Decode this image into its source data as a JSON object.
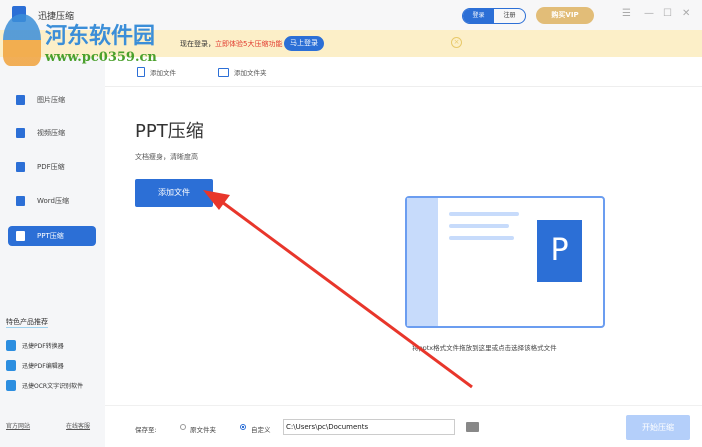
{
  "app": {
    "title": "迅捷压缩"
  },
  "header": {
    "login": "登录",
    "register": "注册",
    "vip": "购买VIP"
  },
  "banner": {
    "text": "现在登录，",
    "highlight": "立即体验5大压缩功能",
    "button": "马上登录"
  },
  "sidebar": {
    "items": [
      {
        "label": "图片压缩"
      },
      {
        "label": "视频压缩"
      },
      {
        "label": "PDF压缩"
      },
      {
        "label": "Word压缩"
      },
      {
        "label": "PPT压缩",
        "active": true
      }
    ],
    "rec_title": "特色产品推荐",
    "recs": [
      {
        "label": "迅捷PDF转换器"
      },
      {
        "label": "迅捷PDF编辑器"
      },
      {
        "label": "迅捷OCR文字识别软件"
      }
    ],
    "footer_links": [
      "官方网站",
      "在线客服"
    ]
  },
  "toolbar": {
    "add_file": "添加文件",
    "add_folder": "添加文件夹"
  },
  "main": {
    "title": "PPT压缩",
    "subtitle": "文档瘦身，清晰度高",
    "add_button": "添加文件",
    "drop_hint": "将pptx格式文件拖放到这里或点击选择该格式文件",
    "card_letter": "P"
  },
  "footer": {
    "save_to": "保存至:",
    "opt_original": "原文件夹",
    "opt_custom": "自定义",
    "path": "C:\\Users\\pc\\Documents",
    "start": "开始压缩"
  },
  "watermark": {
    "name": "河东软件园",
    "url": "www.pc0359.cn"
  },
  "colors": {
    "accent": "#2c6fd6",
    "banner": "#fcefc8",
    "arrow": "#e8362b"
  }
}
